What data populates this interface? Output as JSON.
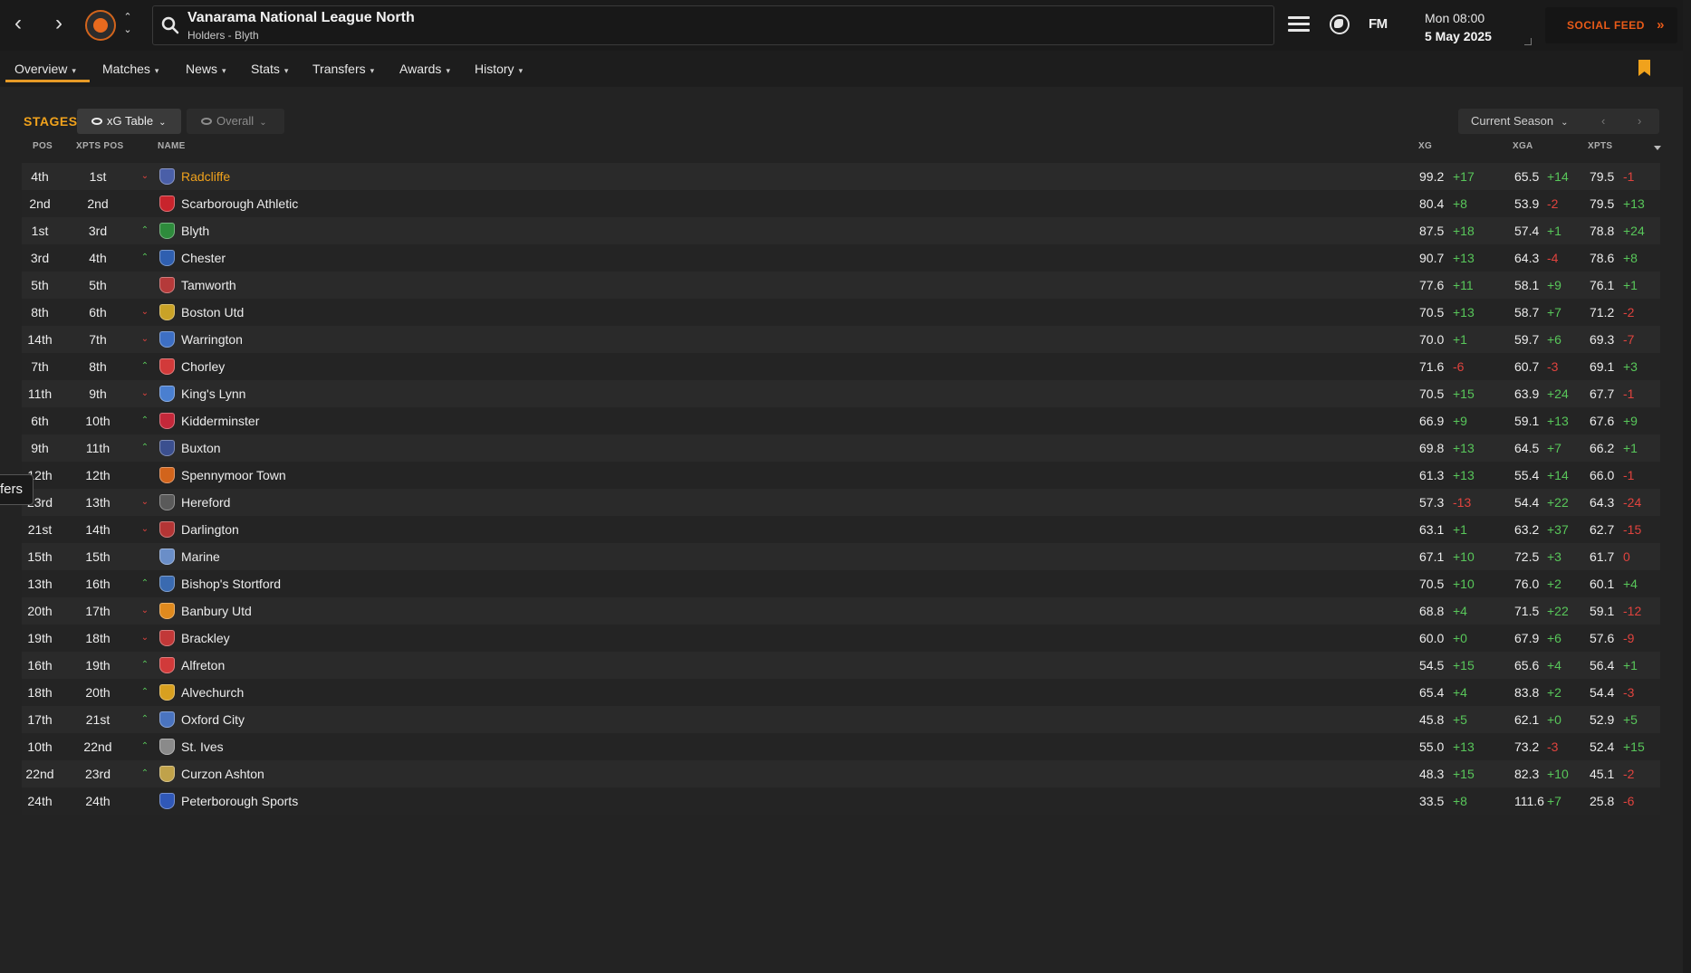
{
  "header": {
    "title": "Vanarama National League North",
    "subtitle": "Holders - Blyth",
    "back_icon": "chevron-left-icon",
    "forward_icon": "chevron-right-icon",
    "time": "Mon 08:00",
    "date": "5 May 2025",
    "fm_label": "FM",
    "social_feed_label": "SOCIAL FEED",
    "social_feed_chevron": "»"
  },
  "subnav": {
    "tabs": [
      {
        "label": "Overview"
      },
      {
        "label": "Matches"
      },
      {
        "label": "News"
      },
      {
        "label": "Stats"
      },
      {
        "label": "Transfers"
      },
      {
        "label": "Awards"
      },
      {
        "label": "History"
      }
    ]
  },
  "controls": {
    "stages_label": "STAGES",
    "view_label": "xG Table",
    "filter_label": "Overall",
    "season_label": "Current Season"
  },
  "table": {
    "columns": {
      "pos": "POS",
      "xpts_pos": "XPTS POS",
      "name": "NAME",
      "xg": "XG",
      "xga": "XGA",
      "xpts": "XPTS"
    },
    "rows": [
      {
        "pos": "4th",
        "xpts_pos": "1st",
        "trend": "down",
        "name": "Radcliffe",
        "badge": "#4a5fa8",
        "xg": "99.2",
        "xg_diff": "+17",
        "xga": "65.5",
        "xga_diff": "+14",
        "xpts": "79.5",
        "xpts_diff": "-1"
      },
      {
        "pos": "2nd",
        "xpts_pos": "2nd",
        "trend": "none",
        "name": "Scarborough Athletic",
        "badge": "#c8242c",
        "xg": "80.4",
        "xg_diff": "+8",
        "xga": "53.9",
        "xga_diff": "-2",
        "xpts": "79.5",
        "xpts_diff": "+13"
      },
      {
        "pos": "1st",
        "xpts_pos": "3rd",
        "trend": "up",
        "name": "Blyth",
        "badge": "#2e8b3c",
        "xg": "87.5",
        "xg_diff": "+18",
        "xga": "57.4",
        "xga_diff": "+1",
        "xpts": "78.8",
        "xpts_diff": "+24"
      },
      {
        "pos": "3rd",
        "xpts_pos": "4th",
        "trend": "up",
        "name": "Chester",
        "badge": "#2f5fb0",
        "xg": "90.7",
        "xg_diff": "+13",
        "xga": "64.3",
        "xga_diff": "-4",
        "xpts": "78.6",
        "xpts_diff": "+8"
      },
      {
        "pos": "5th",
        "xpts_pos": "5th",
        "trend": "none",
        "name": "Tamworth",
        "badge": "#b53a3a",
        "xg": "77.6",
        "xg_diff": "+11",
        "xga": "58.1",
        "xga_diff": "+9",
        "xpts": "76.1",
        "xpts_diff": "+1"
      },
      {
        "pos": "8th",
        "xpts_pos": "6th",
        "trend": "down",
        "name": "Boston Utd",
        "badge": "#c9a227",
        "xg": "70.5",
        "xg_diff": "+13",
        "xga": "58.7",
        "xga_diff": "+7",
        "xpts": "71.2",
        "xpts_diff": "-2"
      },
      {
        "pos": "14th",
        "xpts_pos": "7th",
        "trend": "down",
        "name": "Warrington",
        "badge": "#3d6fc4",
        "xg": "70.0",
        "xg_diff": "+1",
        "xga": "59.7",
        "xga_diff": "+6",
        "xpts": "69.3",
        "xpts_diff": "-7"
      },
      {
        "pos": "7th",
        "xpts_pos": "8th",
        "trend": "up",
        "name": "Chorley",
        "badge": "#d23a3a",
        "xg": "71.6",
        "xg_diff": "-6",
        "xga": "60.7",
        "xga_diff": "-3",
        "xpts": "69.1",
        "xpts_diff": "+3"
      },
      {
        "pos": "11th",
        "xpts_pos": "9th",
        "trend": "down",
        "name": "King's Lynn",
        "badge": "#4a7fd0",
        "xg": "70.5",
        "xg_diff": "+15",
        "xga": "63.9",
        "xga_diff": "+24",
        "xpts": "67.7",
        "xpts_diff": "-1"
      },
      {
        "pos": "6th",
        "xpts_pos": "10th",
        "trend": "up",
        "name": "Kidderminster",
        "badge": "#c4283a",
        "xg": "66.9",
        "xg_diff": "+9",
        "xga": "59.1",
        "xga_diff": "+13",
        "xpts": "67.6",
        "xpts_diff": "+9"
      },
      {
        "pos": "9th",
        "xpts_pos": "11th",
        "trend": "up",
        "name": "Buxton",
        "badge": "#3b4f8f",
        "xg": "69.8",
        "xg_diff": "+13",
        "xga": "64.5",
        "xga_diff": "+7",
        "xpts": "66.2",
        "xpts_diff": "+1"
      },
      {
        "pos": "12th",
        "xpts_pos": "12th",
        "trend": "none",
        "name": "Spennymoor Town",
        "badge": "#d2641c",
        "xg": "61.3",
        "xg_diff": "+13",
        "xga": "55.4",
        "xga_diff": "+14",
        "xpts": "66.0",
        "xpts_diff": "-1"
      },
      {
        "pos": "23rd",
        "xpts_pos": "13th",
        "trend": "down",
        "name": "Hereford",
        "badge": "#5a5a5a",
        "xg": "57.3",
        "xg_diff": "-13",
        "xga": "54.4",
        "xga_diff": "+22",
        "xpts": "64.3",
        "xpts_diff": "-24"
      },
      {
        "pos": "21st",
        "xpts_pos": "14th",
        "trend": "down",
        "name": "Darlington",
        "badge": "#b33535",
        "xg": "63.1",
        "xg_diff": "+1",
        "xga": "63.2",
        "xga_diff": "+37",
        "xpts": "62.7",
        "xpts_diff": "-15"
      },
      {
        "pos": "15th",
        "xpts_pos": "15th",
        "trend": "none",
        "name": "Marine",
        "badge": "#6a8ec8",
        "xg": "67.1",
        "xg_diff": "+10",
        "xga": "72.5",
        "xga_diff": "+3",
        "xpts": "61.7",
        "xpts_diff": "0"
      },
      {
        "pos": "13th",
        "xpts_pos": "16th",
        "trend": "up",
        "name": "Bishop's Stortford",
        "badge": "#3a6ab0",
        "xg": "70.5",
        "xg_diff": "+10",
        "xga": "76.0",
        "xga_diff": "+2",
        "xpts": "60.1",
        "xpts_diff": "+4"
      },
      {
        "pos": "20th",
        "xpts_pos": "17th",
        "trend": "down",
        "name": "Banbury Utd",
        "badge": "#e08a1e",
        "xg": "68.8",
        "xg_diff": "+4",
        "xga": "71.5",
        "xga_diff": "+22",
        "xpts": "59.1",
        "xpts_diff": "-12"
      },
      {
        "pos": "19th",
        "xpts_pos": "18th",
        "trend": "down",
        "name": "Brackley",
        "badge": "#c23838",
        "xg": "60.0",
        "xg_diff": "+0",
        "xga": "67.9",
        "xga_diff": "+6",
        "xpts": "57.6",
        "xpts_diff": "-9"
      },
      {
        "pos": "16th",
        "xpts_pos": "19th",
        "trend": "up",
        "name": "Alfreton",
        "badge": "#d13a3a",
        "xg": "54.5",
        "xg_diff": "+15",
        "xga": "65.6",
        "xga_diff": "+4",
        "xpts": "56.4",
        "xpts_diff": "+1"
      },
      {
        "pos": "18th",
        "xpts_pos": "20th",
        "trend": "up",
        "name": "Alvechurch",
        "badge": "#d8a020",
        "xg": "65.4",
        "xg_diff": "+4",
        "xga": "83.8",
        "xga_diff": "+2",
        "xpts": "54.4",
        "xpts_diff": "-3"
      },
      {
        "pos": "17th",
        "xpts_pos": "21st",
        "trend": "up",
        "name": "Oxford City",
        "badge": "#4a74c0",
        "xg": "45.8",
        "xg_diff": "+5",
        "xga": "62.1",
        "xga_diff": "+0",
        "xpts": "52.9",
        "xpts_diff": "+5"
      },
      {
        "pos": "10th",
        "xpts_pos": "22nd",
        "trend": "up",
        "name": "St. Ives",
        "badge": "#8a8a8a",
        "xg": "55.0",
        "xg_diff": "+13",
        "xga": "73.2",
        "xga_diff": "-3",
        "xpts": "52.4",
        "xpts_diff": "+15"
      },
      {
        "pos": "22nd",
        "xpts_pos": "23rd",
        "trend": "up",
        "name": "Curzon Ashton",
        "badge": "#c0a24a",
        "xg": "48.3",
        "xg_diff": "+15",
        "xga": "82.3",
        "xga_diff": "+10",
        "xpts": "45.1",
        "xpts_diff": "-2"
      },
      {
        "pos": "24th",
        "xpts_pos": "24th",
        "trend": "none",
        "name": "Peterborough Sports",
        "badge": "#3058b8",
        "xg": "33.5",
        "xg_diff": "+8",
        "xga": "111.6",
        "xga_diff": "+7",
        "xpts": "25.8",
        "xpts_diff": "-6"
      }
    ]
  },
  "side_tip": {
    "label": "fers"
  },
  "colors": {
    "accent": "#f0a21c",
    "positive": "#58c75a",
    "negative": "#e0433e",
    "social_feed": "#e85a18"
  }
}
